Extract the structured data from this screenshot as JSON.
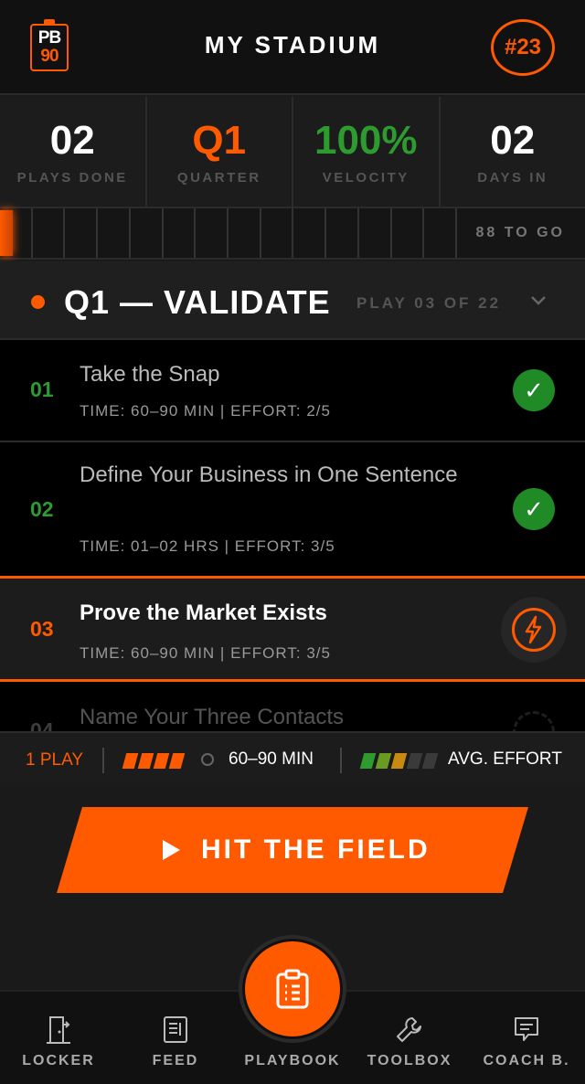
{
  "header": {
    "logo_top": "PB",
    "logo_bottom": "90",
    "title": "MY STADIUM",
    "rank": "#23"
  },
  "stats": [
    {
      "value": "02",
      "label": "PLAYS DONE",
      "color": "#ffffff"
    },
    {
      "value": "Q1",
      "label": "QUARTER",
      "color": "#ff5a00"
    },
    {
      "value": "100%",
      "label": "VELOCITY",
      "color": "#2e9b2e"
    },
    {
      "value": "02",
      "label": "DAYS IN",
      "color": "#ffffff"
    }
  ],
  "progress": {
    "completed_fraction": 0.02,
    "to_go": "88 TO GO"
  },
  "quarter": {
    "title": "Q1 — VALIDATE",
    "play_counter": "PLAY 03 OF 22"
  },
  "plays": [
    {
      "num": "01",
      "title": "Take the Snap",
      "meta": "TIME: 60–90 MIN  |  EFFORT: 2/5",
      "status": "done"
    },
    {
      "num": "02",
      "title": "Define Your Business in One Sentence",
      "meta": "TIME: 01–02 HRS  |  EFFORT: 3/5",
      "status": "done"
    },
    {
      "num": "03",
      "title": "Prove the Market Exists",
      "meta": "TIME: 60–90 MIN  |  EFFORT: 3/5",
      "status": "active"
    },
    {
      "num": "04",
      "title": "Name Your Three Contacts",
      "meta": "",
      "status": "locked"
    }
  ],
  "summary": {
    "plays": "1 PLAY",
    "time": "60–90 MIN",
    "effort_label": "AVG. EFFORT",
    "effort_level": 3
  },
  "cta": {
    "label": "HIT THE FIELD"
  },
  "nav": [
    {
      "label": "LOCKER",
      "icon": "locker-door-icon"
    },
    {
      "label": "FEED",
      "icon": "feed-icon"
    },
    {
      "label": "PLAYBOOK",
      "icon": "clipboard-icon"
    },
    {
      "label": "TOOLBOX",
      "icon": "wrench-icon"
    },
    {
      "label": "COACH B.",
      "icon": "chat-icon"
    }
  ],
  "colors": {
    "accent": "#ff5a00",
    "success": "#1f8a26",
    "background": "#1a1a1a"
  }
}
